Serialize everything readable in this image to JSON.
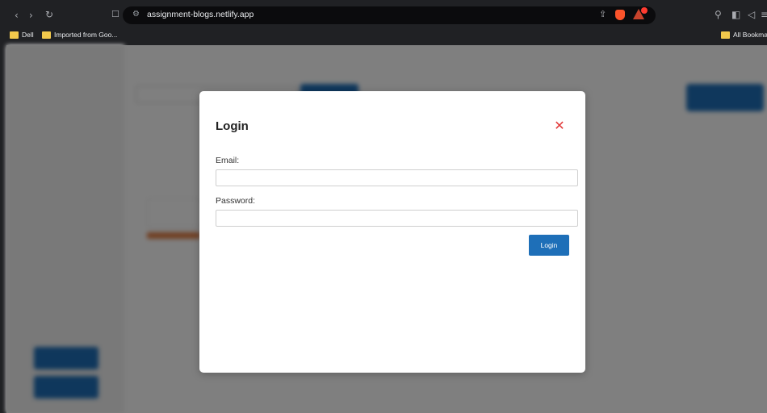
{
  "browser": {
    "url": "assignment-blogs.netlify.app",
    "bookmarks": [
      {
        "label": "Dell"
      },
      {
        "label": "Imported from Goo..."
      }
    ],
    "all_bookmarks": "All Bookmarks"
  },
  "login_modal": {
    "title": "Login",
    "email_label": "Email:",
    "email_value": "",
    "password_label": "Password:",
    "password_value": "",
    "submit_label": "Login"
  },
  "colors": {
    "primary_button": "#1e6fb8",
    "close_icon": "#e23a3a"
  }
}
